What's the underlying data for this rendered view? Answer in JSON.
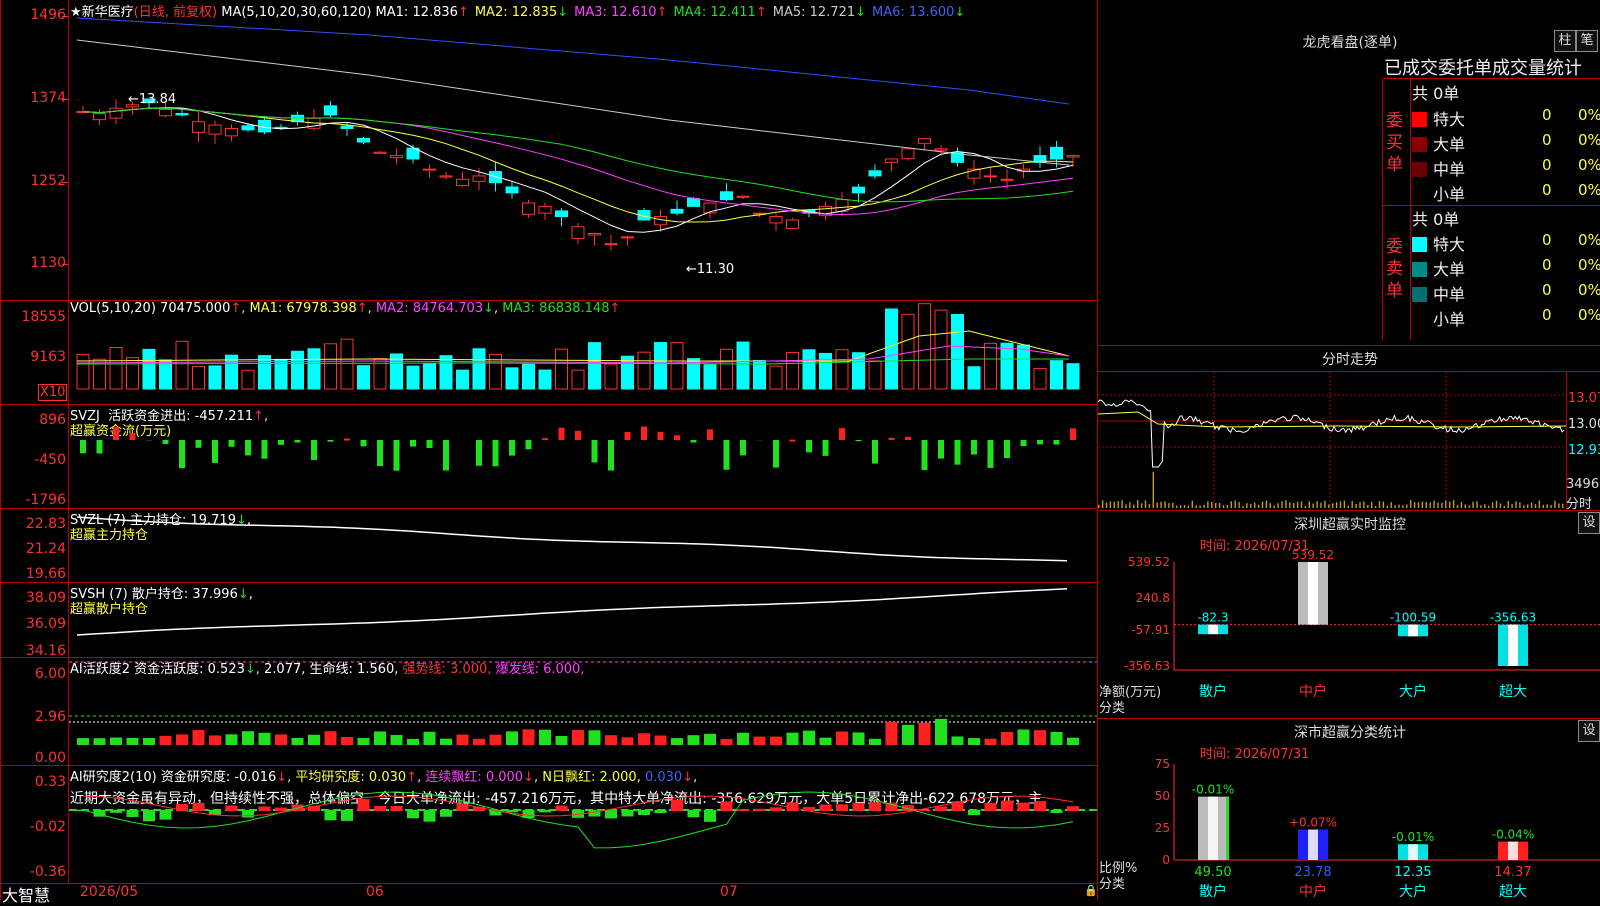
{
  "stock": {
    "star": "★",
    "name": "新华医疗",
    "mode": "(日线, 前复权)"
  },
  "main_ma": {
    "prefix": "MA(5,10,20,30,60,120)",
    "items": [
      {
        "label": "MA1: 12.836",
        "arrow": "↑",
        "color": "#ffffff"
      },
      {
        "label": "MA2: 12.835",
        "arrow": "↓",
        "color": "#ffff40"
      },
      {
        "label": "MA3: 12.610",
        "arrow": "↑",
        "color": "#ff40ff"
      },
      {
        "label": "MA4: 12.411",
        "arrow": "↑",
        "color": "#20e020"
      },
      {
        "label": "MA5: 12.721",
        "arrow": "↓",
        "color": "#cccccc"
      },
      {
        "label": "MA6: 13.600",
        "arrow": "↓",
        "color": "#4060ff"
      }
    ]
  },
  "main_axis": [
    "1496",
    "1374",
    "1252",
    "1130"
  ],
  "main_annot": {
    "high": "←13.84",
    "low": "←11.30"
  },
  "vol": {
    "prefix": "VOL(5,10,20)",
    "val": "70475.000",
    "ma1": "MA1: 67978.398",
    "ma2": "MA2: 84764.703",
    "ma3": "MA3: 86838.148",
    "axis": [
      "18555",
      "9163"
    ],
    "unit": "X10"
  },
  "svzj": {
    "prefix": "SVZJ",
    "label": "活跃资金进出: -457.211",
    "sub": "超赢资金流(万元)",
    "axis": [
      "896",
      "-450",
      "-1796"
    ]
  },
  "svzl": {
    "label": "SVZL (7) 主力持仓: 19.719",
    "sub": "超赢主力持仓",
    "axis": [
      "22.83",
      "21.24",
      "19.66"
    ]
  },
  "svsh": {
    "label": "SVSH (7) 散户持仓: 37.996",
    "sub": "超赢散户持仓",
    "axis": [
      "38.09",
      "36.09",
      "34.16"
    ]
  },
  "ai1": {
    "label": "AI活跃度2 资金活跃度: 0.523",
    "v2": "2.077,",
    "life": "生命线: 1.560,",
    "strong": "强势线: 3.000,",
    "burst": "爆发线: 6.000,",
    "axis": [
      "6.00",
      "2.96",
      "0.00"
    ]
  },
  "ai2": {
    "label": "AI研究度2(10) 资金研究度: -0.016",
    "avg": "平均研究度: 0.030",
    "red": "连续飘红: 0.000",
    "nred": "N日飘红: 2.000,",
    "last": "0.030",
    "note": "近期大资金虽有异动，但持续性不强，总体偏空，今日大单净流出: -457.216万元，其中特大单净流出: -356.629万元，大单5日累计净出-622.678万元，主",
    "axis": [
      "0.33",
      "-0.02",
      "-0.36"
    ]
  },
  "bottom": {
    "brand": "大智慧",
    "months": [
      "2026/05",
      "06",
      "07"
    ]
  },
  "lhb": {
    "title": "龙虎看盘(逐单)",
    "btn1": "柱",
    "btn2": "笔",
    "header": "已成交委托单成交量统计",
    "buy": {
      "side": "委买单",
      "total": "共 0单",
      "rows": [
        {
          "name": "特大",
          "color": "#ff0000",
          "count": "0",
          "pct": "0%"
        },
        {
          "name": "大单",
          "color": "#8a0000",
          "count": "0",
          "pct": "0%"
        },
        {
          "name": "中单",
          "color": "#6a0000",
          "count": "0",
          "pct": "0%"
        },
        {
          "name": "小单",
          "color": "#000000",
          "count": "0",
          "pct": "0%"
        }
      ]
    },
    "sell": {
      "side": "委卖单",
      "total": "共 0单",
      "rows": [
        {
          "name": "特大",
          "color": "#00ffff",
          "count": "0",
          "pct": "0%"
        },
        {
          "name": "大单",
          "color": "#008b8b",
          "count": "0",
          "pct": "0%"
        },
        {
          "name": "中单",
          "color": "#007070",
          "count": "0",
          "pct": "0%"
        },
        {
          "name": "小单",
          "color": "#000000",
          "count": "0",
          "pct": "0%"
        }
      ]
    }
  },
  "fenshi": {
    "title": "分时走势",
    "axis": [
      "13.07",
      "13.00",
      "12.93"
    ],
    "vol": "3496",
    "unit": "分时"
  },
  "monitor": {
    "title": "深圳超赢实时监控",
    "btn": "设",
    "time": "时间: 2026/07/31",
    "axis": [
      "539.52",
      "240.8",
      "-57.91",
      "-356.63"
    ],
    "ylabel": "净额(万元)",
    "xlabel": "分类",
    "cats": [
      "散户",
      "中户",
      "大户",
      "超大"
    ],
    "vals": [
      "-82.3",
      "539.52",
      "-100.59",
      "-356.63"
    ]
  },
  "classify": {
    "title": "深市超赢分类统计",
    "btn": "设",
    "time": "时间: 2026/07/31",
    "axis": [
      "75",
      "50",
      "25",
      "0"
    ],
    "ylabel": "比例%",
    "xlabel": "分类",
    "cats": [
      "散户",
      "中户",
      "大户",
      "超大"
    ],
    "vals": [
      "49.50",
      "23.78",
      "12.35",
      "14.37"
    ],
    "chg": [
      "-0.01%",
      "+0.07%",
      "-0.01%",
      "-0.04%"
    ]
  },
  "chart_data": [
    {
      "type": "bar",
      "title": "深圳超赢实时监控",
      "categories": [
        "散户",
        "中户",
        "大户",
        "超大"
      ],
      "values": [
        -82.3,
        539.52,
        -100.59,
        -356.63
      ],
      "ylabel": "净额(万元)",
      "xlabel": "分类",
      "ylim": [
        -356.63,
        539.52
      ]
    },
    {
      "type": "bar",
      "title": "深市超赢分类统计",
      "categories": [
        "散户",
        "中户",
        "大户",
        "超大"
      ],
      "values": [
        49.5,
        23.78,
        12.35,
        14.37
      ],
      "ylabel": "比例%",
      "xlabel": "分类",
      "ylim": [
        0,
        75
      ]
    }
  ]
}
